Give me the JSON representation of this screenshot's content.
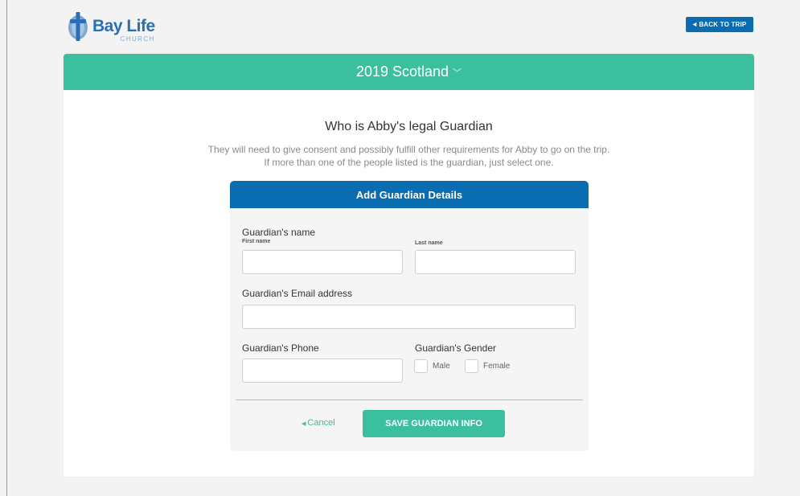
{
  "brand": {
    "name": "Bay Life",
    "sub": "CHURCH",
    "color": "#2a6fb3"
  },
  "header": {
    "back_label": "BACK TO TRIP"
  },
  "trip": {
    "title": "2019 Scotland",
    "chevron": "chevron-down-icon"
  },
  "intro": {
    "heading": "Who is Abby's legal Guardian",
    "line1": "They will need to give consent and possibly fulfill other requirements for Abby to go on the trip.",
    "line2": "If more than one of the people listed is the guardian, just select one."
  },
  "form": {
    "title": "Add Guardian Details",
    "name_label": "Guardian's name",
    "first_name_label": "First name",
    "first_name_value": "",
    "last_name_label": "Last name",
    "last_name_value": "",
    "email_label": "Guardian's Email address",
    "email_value": "",
    "phone_label": "Guardian's Phone",
    "phone_value": "",
    "gender_label": "Guardian's Gender",
    "gender_options": [
      "Male",
      "Female"
    ],
    "cancel_label": "Cancel",
    "save_label": "SAVE GUARDIAN INFO"
  },
  "colors": {
    "accent_green": "#3bbf9f",
    "accent_blue": "#0a6cb1",
    "background": "#f3f3f3"
  }
}
